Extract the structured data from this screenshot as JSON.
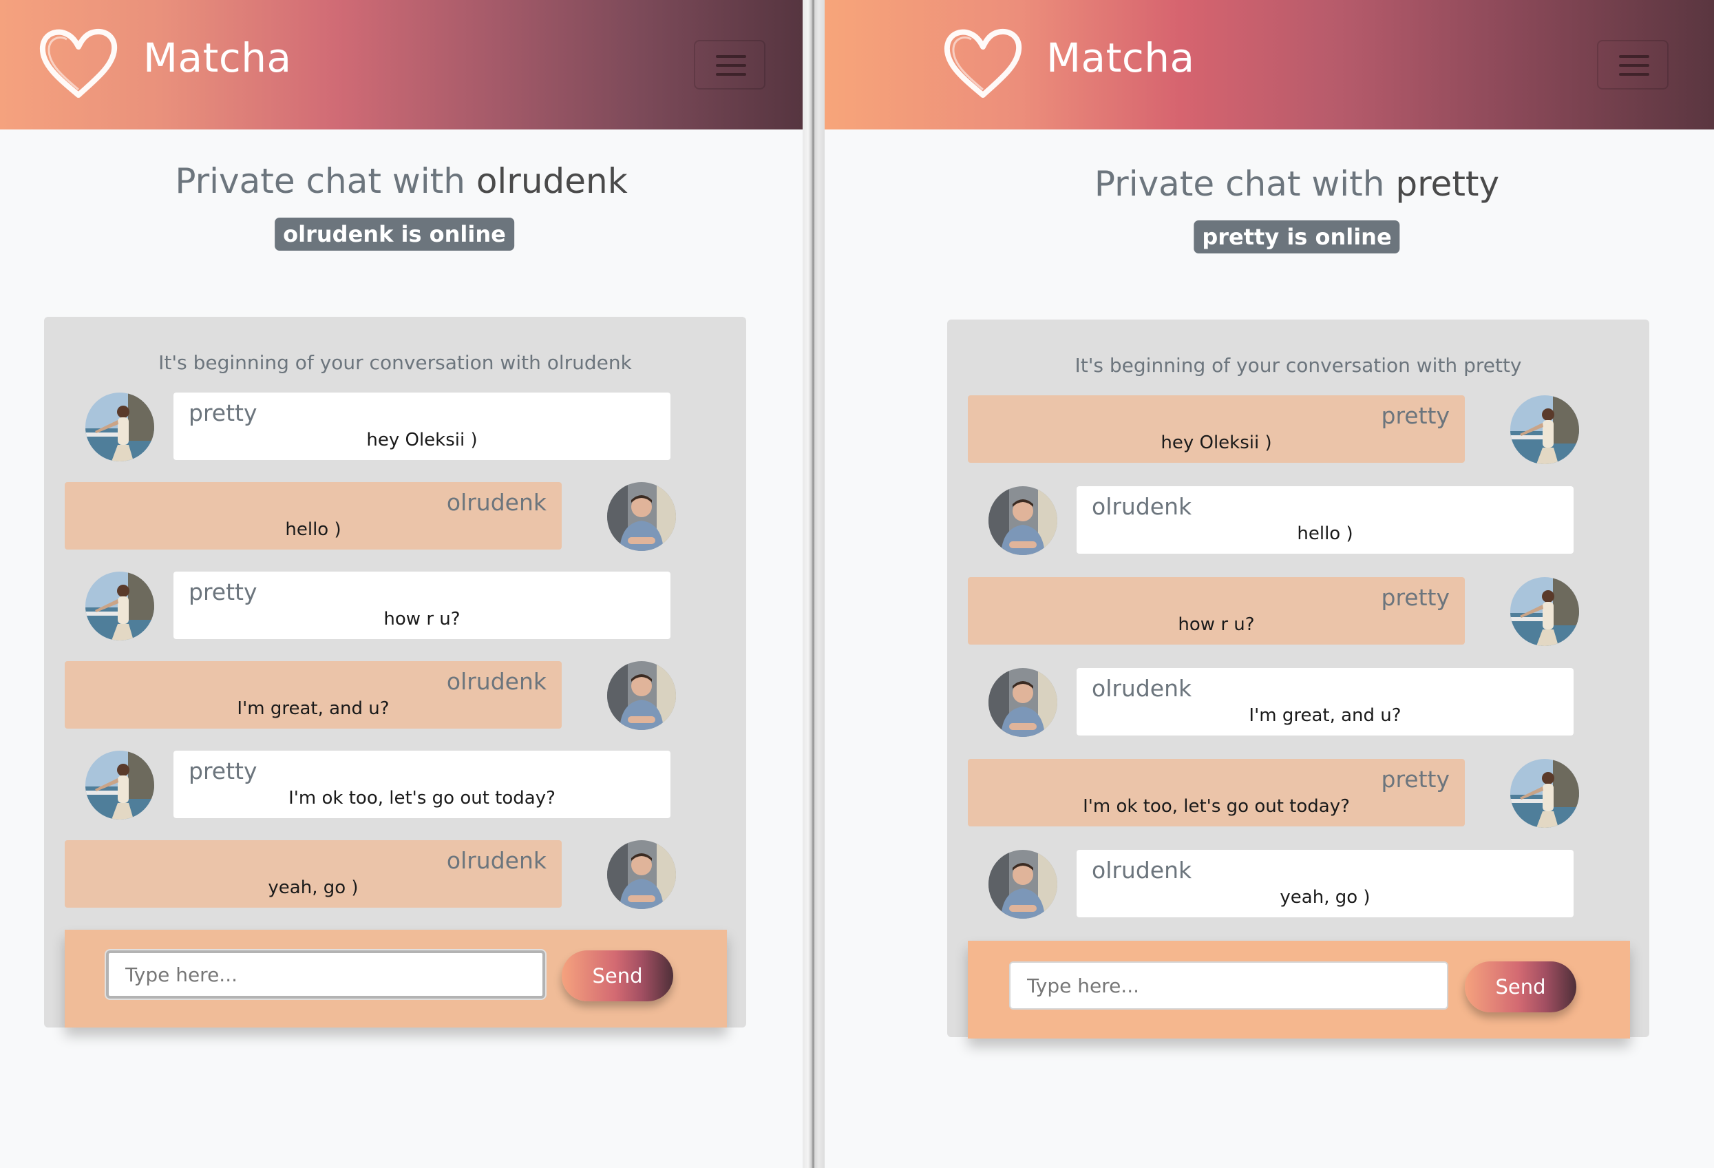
{
  "app": {
    "brand": "Matcha"
  },
  "colors": {
    "header_gradient_start": "#f5a27e",
    "header_gradient_end": "#563540",
    "badge": "#6c757d",
    "chat_box": "#dedede",
    "self_bubble": "#ebc4a9",
    "other_bubble": "#ffffff",
    "composer": "#f0bc98"
  },
  "icons": {
    "logo": "heart-icon",
    "menu": "hamburger-icon"
  },
  "left": {
    "title_prefix": "Private chat with ",
    "partner": "olrudenk",
    "status": "olrudenk is online",
    "conversation_start": "It's beginning of your conversation with olrudenk",
    "messages": [
      {
        "sender": "pretty",
        "text": "hey Oleksii )"
      },
      {
        "sender": "olrudenk",
        "text": "hello )"
      },
      {
        "sender": "pretty",
        "text": "how r u?"
      },
      {
        "sender": "olrudenk",
        "text": "I'm great, and u?"
      },
      {
        "sender": "pretty",
        "text": "I'm ok too, let's go out today?"
      },
      {
        "sender": "olrudenk",
        "text": "yeah, go )"
      }
    ],
    "input": {
      "placeholder": "Type here...",
      "value": ""
    },
    "send_label": "Send"
  },
  "right": {
    "title_prefix": "Private chat with ",
    "partner": "pretty",
    "status": "pretty is online",
    "conversation_start": "It's beginning of your conversation with pretty",
    "messages": [
      {
        "sender": "pretty",
        "text": "hey Oleksii )"
      },
      {
        "sender": "olrudenk",
        "text": "hello )"
      },
      {
        "sender": "pretty",
        "text": "how r u?"
      },
      {
        "sender": "olrudenk",
        "text": "I'm great, and u?"
      },
      {
        "sender": "pretty",
        "text": "I'm ok too, let's go out today?"
      },
      {
        "sender": "olrudenk",
        "text": "yeah, go )"
      }
    ],
    "input": {
      "placeholder": "Type here...",
      "value": ""
    },
    "send_label": "Send"
  }
}
